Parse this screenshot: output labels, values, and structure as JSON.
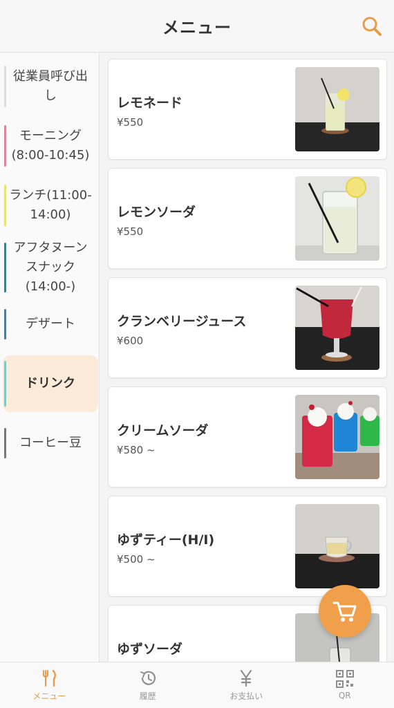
{
  "header": {
    "title": "メニュー",
    "search_icon": "search-icon"
  },
  "colors": {
    "accent": "#f0a04a",
    "active_bg": "#fcebd9"
  },
  "sidebar": {
    "items": [
      {
        "label": "従業員呼び出し",
        "bar_color": "#dddddd",
        "active": false
      },
      {
        "label": "モーニング(8:00-10:45)",
        "bar_color": "#d9869a",
        "active": false
      },
      {
        "label": "ランチ(11:00-14:00)",
        "bar_color": "#e8e07a",
        "active": false
      },
      {
        "label": "アフタヌーンスナック(14:00-)",
        "bar_color": "#3f7e8c",
        "active": false
      },
      {
        "label": "デザート",
        "bar_color": "#4d7a9a",
        "active": false
      },
      {
        "label": "ドリンク",
        "bar_color": "#7ec8c8",
        "active": true
      },
      {
        "label": "コーヒー豆",
        "bar_color": "#777777",
        "active": false
      }
    ]
  },
  "menu": {
    "items": [
      {
        "name": "レモネード",
        "price": "¥550"
      },
      {
        "name": "レモンソーダ",
        "price": "¥550"
      },
      {
        "name": "クランベリージュース",
        "price": "¥600"
      },
      {
        "name": "クリームソーダ",
        "price": "¥580 ~"
      },
      {
        "name": "ゆずティー(H/I)",
        "price": "¥500 ~"
      },
      {
        "name": "ゆずソーダ",
        "price": ""
      }
    ]
  },
  "tabbar": {
    "tabs": [
      {
        "label": "メニュー",
        "icon": "fork-knife-icon",
        "active": true
      },
      {
        "label": "履歴",
        "icon": "history-icon",
        "active": false
      },
      {
        "label": "お支払い",
        "icon": "yen-icon",
        "active": false
      },
      {
        "label": "QR",
        "icon": "qr-code-icon",
        "active": false
      }
    ]
  },
  "cart": {
    "icon": "cart-icon"
  }
}
